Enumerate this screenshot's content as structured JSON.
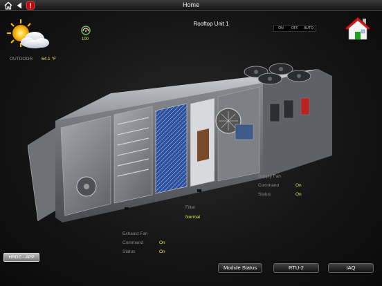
{
  "header": {
    "title": "Home"
  },
  "unit": {
    "title": "Rooftop Unit 1"
  },
  "mode_switch": {
    "options": [
      "ON",
      "OFF",
      "AUTO"
    ]
  },
  "outdoor": {
    "label": "OUTDOOR",
    "value": "64.1 °F"
  },
  "gauge": {
    "value": "100"
  },
  "filter": {
    "label": "Filter",
    "status": "Normal"
  },
  "supply_fan": {
    "label": "Supply Fan",
    "command_label": "Command",
    "command_value": "On",
    "status_label": "Status",
    "status_value": "On"
  },
  "exhaust_fan": {
    "label": "Exhaust Fan",
    "command_label": "Command",
    "command_value": "On",
    "status_label": "Status",
    "status_value": "On"
  },
  "buttons": {
    "hrdc": "HRDC - APP",
    "module_status": "Module Status",
    "rtu2": "RTU-2",
    "iaq": "IAQ"
  },
  "icons": {
    "home": "home-icon",
    "back": "back-arrow-icon",
    "alert": "alert-icon",
    "weather": "partly-sunny-icon",
    "gauge": "gauge-icon",
    "house": "house-icon"
  },
  "colors": {
    "value_yellow": "#e8e84a",
    "alert_red": "#d40000",
    "house_red": "#d01818",
    "house_green": "#1fa31f"
  }
}
